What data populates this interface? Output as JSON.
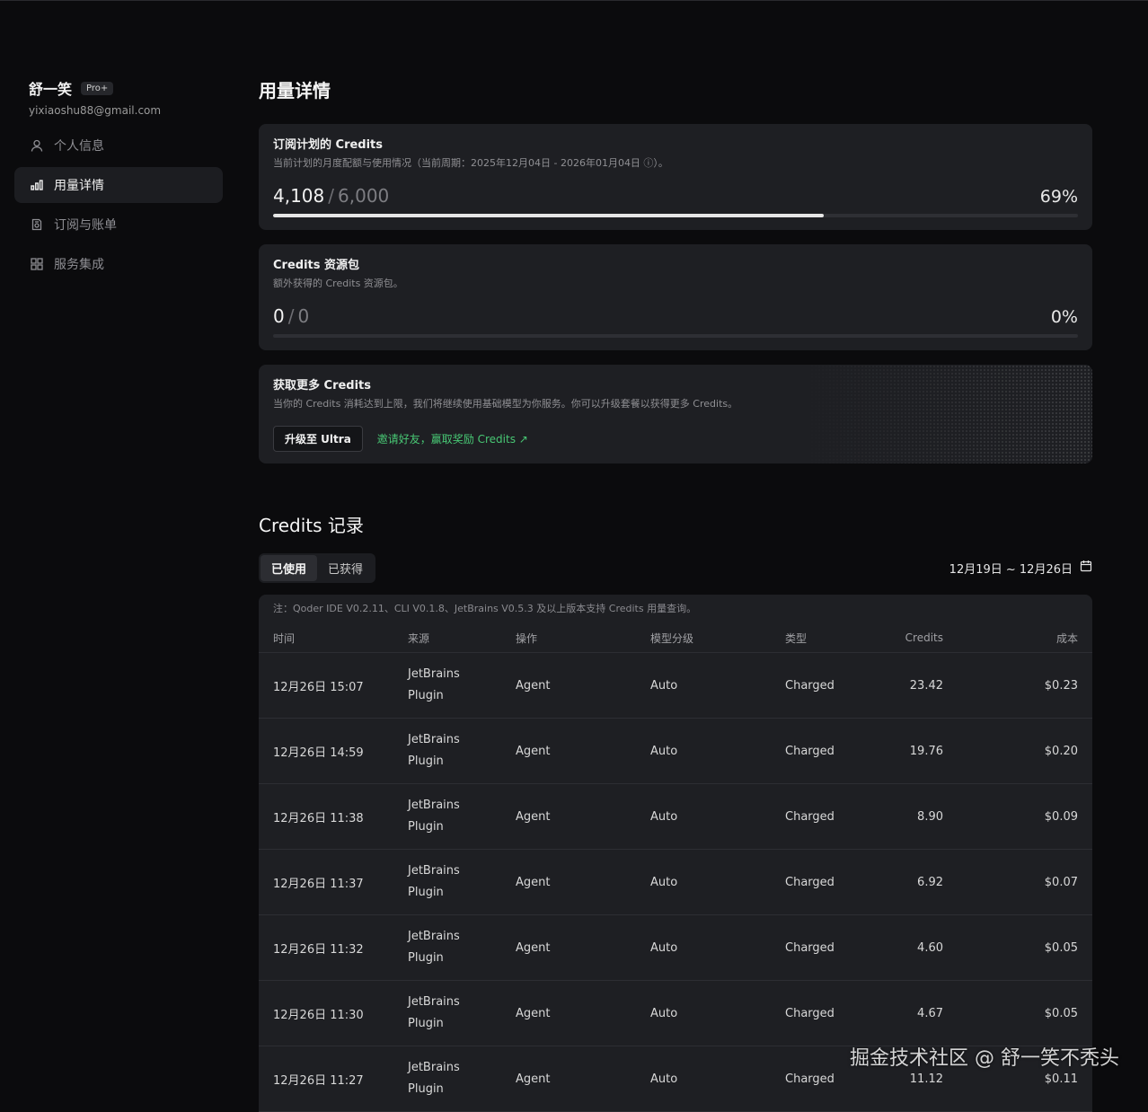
{
  "user": {
    "name": "舒一笑",
    "plan": "Pro+",
    "email": "yixiaoshu88@gmail.com"
  },
  "nav": [
    {
      "label": "个人信息",
      "icon": "user-icon",
      "active": false
    },
    {
      "label": "用量详情",
      "icon": "bar-chart-icon",
      "active": true
    },
    {
      "label": "订阅与账单",
      "icon": "receipt-icon",
      "active": false
    },
    {
      "label": "服务集成",
      "icon": "grid-icon",
      "active": false
    }
  ],
  "page_title": "用量详情",
  "plan_credits": {
    "title": "订阅计划的 Credits",
    "subtitle": "当前计划的月度配额与使用情况（当前周期：2025年12月04日 - 2026年01月04日 ⓘ）。",
    "used": "4,108",
    "total": "6,000",
    "percent": "69%",
    "progress": 0.6846
  },
  "pack_credits": {
    "title": "Credits 资源包",
    "subtitle": "额外获得的 Credits 资源包。",
    "used": "0",
    "total": "0",
    "percent": "0%",
    "progress": 0
  },
  "more_credits": {
    "title": "获取更多 Credits",
    "subtitle": "当你的 Credits 消耗达到上限，我们将继续使用基础模型为你服务。你可以升级套餐以获得更多 Credits。",
    "upgrade_label": "升级至 Ultra",
    "invite_label": "邀请好友，赢取奖励 Credits ↗"
  },
  "records": {
    "title": "Credits 记录",
    "tabs": [
      "已使用",
      "已获得"
    ],
    "active_tab": 0,
    "date_range": "12月19日 ~ 12月26日",
    "note": "注：Qoder IDE V0.2.11、CLI V0.1.8、JetBrains V0.5.3 及以上版本支持 Credits 用量查询。",
    "columns": [
      "时间",
      "来源",
      "操作",
      "模型分级",
      "类型",
      "Credits",
      "成本"
    ],
    "rows": [
      {
        "time": "12月26日 15:07",
        "source1": "JetBrains",
        "source2": "Plugin",
        "op": "Agent",
        "tier": "Auto",
        "type": "Charged",
        "credits": "23.42",
        "cost": "$0.23"
      },
      {
        "time": "12月26日 14:59",
        "source1": "JetBrains",
        "source2": "Plugin",
        "op": "Agent",
        "tier": "Auto",
        "type": "Charged",
        "credits": "19.76",
        "cost": "$0.20"
      },
      {
        "time": "12月26日 11:38",
        "source1": "JetBrains",
        "source2": "Plugin",
        "op": "Agent",
        "tier": "Auto",
        "type": "Charged",
        "credits": "8.90",
        "cost": "$0.09"
      },
      {
        "time": "12月26日 11:37",
        "source1": "JetBrains",
        "source2": "Plugin",
        "op": "Agent",
        "tier": "Auto",
        "type": "Charged",
        "credits": "6.92",
        "cost": "$0.07"
      },
      {
        "time": "12月26日 11:32",
        "source1": "JetBrains",
        "source2": "Plugin",
        "op": "Agent",
        "tier": "Auto",
        "type": "Charged",
        "credits": "4.60",
        "cost": "$0.05"
      },
      {
        "time": "12月26日 11:30",
        "source1": "JetBrains",
        "source2": "Plugin",
        "op": "Agent",
        "tier": "Auto",
        "type": "Charged",
        "credits": "4.67",
        "cost": "$0.05"
      },
      {
        "time": "12月26日 11:27",
        "source1": "JetBrains",
        "source2": "Plugin",
        "op": "Agent",
        "tier": "Auto",
        "type": "Charged",
        "credits": "11.12",
        "cost": "$0.11"
      }
    ]
  },
  "watermark": "掘金技术社区 @ 舒一笑不秃头",
  "colors": {
    "background": "#0b0b0d",
    "card": "#1e1f23",
    "accent_green": "#48c774",
    "progress": "#e6e6e6"
  }
}
